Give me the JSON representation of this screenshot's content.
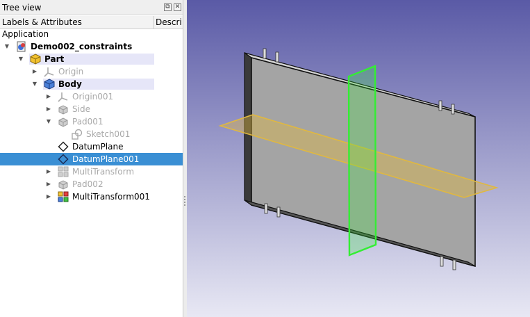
{
  "panel": {
    "title": "Tree view",
    "float_btn": "⧉",
    "close_btn": "✕"
  },
  "headers": {
    "labels": "Labels & Attributes",
    "description": "Descri"
  },
  "tree": {
    "root": "Application",
    "document": "Demo002_constraints",
    "part": "Part",
    "origin": "Origin",
    "body": "Body",
    "origin001": "Origin001",
    "side": "Side",
    "pad001": "Pad001",
    "sketch001": "Sketch001",
    "datumplane": "DatumPlane",
    "datumplane001": "DatumPlane001",
    "multitransform": "MultiTransform",
    "pad002": "Pad002",
    "multitransform001": "MultiTransform001"
  },
  "colors": {
    "selection": "#3a8fd4",
    "viewport_top": "#5a5aa6",
    "viewport_bottom": "#e8e8f4",
    "datum_yellow": "#e0b840",
    "datum_green": "#33ee33"
  }
}
